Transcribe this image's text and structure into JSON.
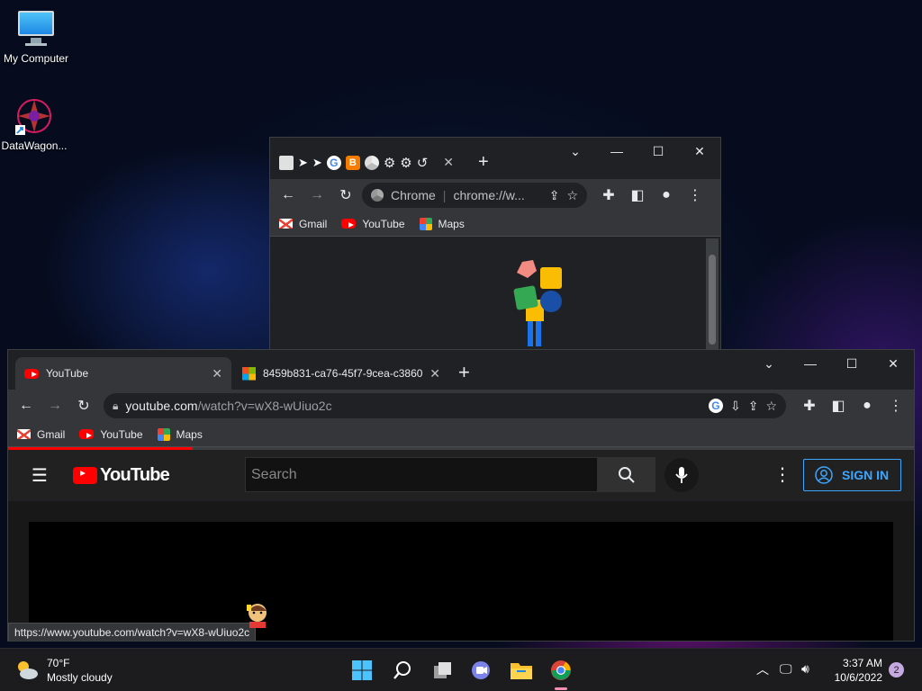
{
  "desktop": {
    "icons": [
      {
        "label": "My Computer"
      },
      {
        "label": "DataWagon..."
      }
    ]
  },
  "back_window": {
    "omnibox_site": "Chrome",
    "omnibox_url": "chrome://w...",
    "bookmarks": [
      "Gmail",
      "YouTube",
      "Maps"
    ]
  },
  "front_window": {
    "tabs": [
      {
        "label": "YouTube"
      },
      {
        "label": "8459b831-ca76-45f7-9cea-c3860"
      }
    ],
    "url_domain": "youtube.com",
    "url_path": "/watch?v=wX8-wUiuo2c",
    "bookmarks": [
      "Gmail",
      "YouTube",
      "Maps"
    ],
    "status_url": "https://www.youtube.com/watch?v=wX8-wUiuo2c"
  },
  "youtube": {
    "logo_text": "YouTube",
    "search_placeholder": "Search",
    "sign_in": "SIGN IN"
  },
  "taskbar": {
    "weather_temp": "70°F",
    "weather_desc": "Mostly cloudy",
    "time": "3:37 AM",
    "date": "10/6/2022",
    "notifications": "2"
  },
  "colors": {
    "youtube_red": "#ff0000",
    "chrome_dark": "#202124",
    "toolbar": "#35363a",
    "sign_in_blue": "#3ea6ff"
  }
}
